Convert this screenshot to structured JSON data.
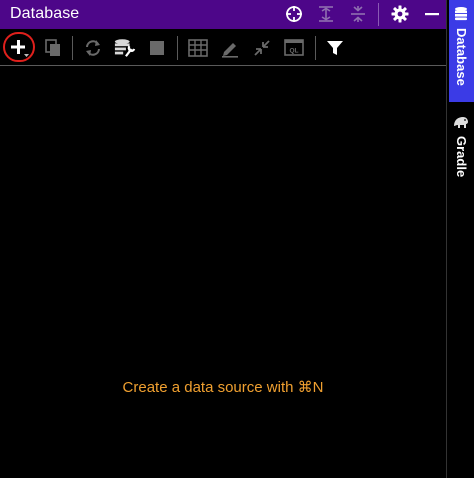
{
  "window": {
    "title": "Database"
  },
  "titlebar_icons": {
    "target": "crosshair-icon",
    "expand": "expand-all-icon",
    "collapse": "collapse-all-icon",
    "settings": "gear-icon",
    "minimize": "minimize-icon"
  },
  "toolbar": {
    "items": [
      {
        "name": "add",
        "icon": "plus-icon"
      },
      {
        "name": "duplicate",
        "icon": "copy-icon"
      },
      {
        "name": "refresh",
        "icon": "refresh-icon"
      },
      {
        "name": "data-source-properties",
        "icon": "database-wrench-icon"
      },
      {
        "name": "stop",
        "icon": "stop-icon"
      },
      {
        "name": "table-view",
        "icon": "table-icon"
      },
      {
        "name": "edit",
        "icon": "pencil-icon"
      },
      {
        "name": "jump-to",
        "icon": "arrows-in-icon"
      },
      {
        "name": "query-console",
        "icon": "ql-console-icon"
      },
      {
        "name": "filter",
        "icon": "funnel-icon"
      }
    ]
  },
  "main": {
    "empty_message": "Create a data source with ⌘N"
  },
  "side_tabs": [
    {
      "label": "Database",
      "icon": "database-icon",
      "active": true
    },
    {
      "label": "Gradle",
      "icon": "gradle-elephant-icon",
      "active": false
    }
  ],
  "colors": {
    "titlebar": "#4d0689",
    "accent_tab": "#3b3be6",
    "message": "#f0a030",
    "highlight_ring": "#e0201c"
  }
}
